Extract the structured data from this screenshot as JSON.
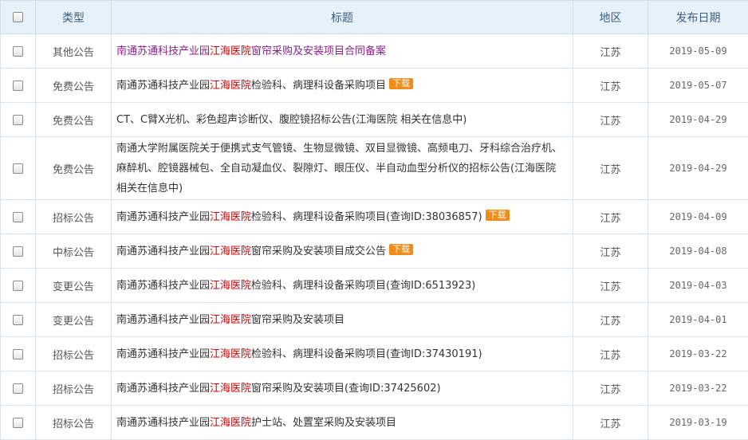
{
  "header": {
    "type": "类型",
    "title": "标题",
    "region": "地区",
    "date": "发布日期"
  },
  "rows": [
    {
      "type": "其他公告",
      "pre": "南通苏通科技产业园",
      "hl": "江海医院",
      "post": "窗帘采购及安装项目合同备案",
      "download": "",
      "region": "江苏",
      "date": "2019-05-09"
    },
    {
      "type": "免费公告",
      "pre": "南通苏通科技产业园",
      "hl": "江海医院",
      "post": "检验科、病理科设备采购项目",
      "download": "下载",
      "region": "江苏",
      "date": "2019-05-07"
    },
    {
      "type": "免费公告",
      "pre": "CT、C臂X光机、彩色超声诊断仪、腹腔镜招标公告(江海医院 相关在信息中)",
      "hl": "",
      "post": "",
      "download": "",
      "region": "江苏",
      "date": "2019-04-29"
    },
    {
      "type": "免费公告",
      "pre": "南通大学附属医院关于便携式支气管镜、生物显微镜、双目显微镜、高频电刀、牙科综合治疗机、麻醉机、腔镜器械包、全自动凝血仪、裂隙灯、眼压仪、半自动血型分析仪的招标公告(江海医院 相关在信息中)",
      "hl": "",
      "post": "",
      "download": "",
      "region": "江苏",
      "date": "2019-04-29"
    },
    {
      "type": "招标公告",
      "pre": "南通苏通科技产业园",
      "hl": "江海医院",
      "post": "检验科、病理科设备采购项目(查询ID:38036857)",
      "download": "下载",
      "region": "江苏",
      "date": "2019-04-09"
    },
    {
      "type": "中标公告",
      "pre": "南通苏通科技产业园",
      "hl": "江海医院",
      "post": "窗帘采购及安装项目成交公告",
      "download": "下载",
      "region": "江苏",
      "date": "2019-04-08"
    },
    {
      "type": "变更公告",
      "pre": "南通苏通科技产业园",
      "hl": "江海医院",
      "post": "检验科、病理科设备采购项目(查询ID:6513923)",
      "download": "",
      "region": "江苏",
      "date": "2019-04-03"
    },
    {
      "type": "变更公告",
      "pre": "南通苏通科技产业园",
      "hl": "江海医院",
      "post": "窗帘采购及安装项目",
      "download": "",
      "region": "江苏",
      "date": "2019-04-01"
    },
    {
      "type": "招标公告",
      "pre": "南通苏通科技产业园",
      "hl": "江海医院",
      "post": "检验科、病理科设备采购项目(查询ID:37430191)",
      "download": "",
      "region": "江苏",
      "date": "2019-03-22"
    },
    {
      "type": "招标公告",
      "pre": "南通苏通科技产业园",
      "hl": "江海医院",
      "post": "窗帘采购及安装项目(查询ID:37425602)",
      "download": "",
      "region": "江苏",
      "date": "2019-03-22"
    },
    {
      "type": "招标公告",
      "pre": "南通苏通科技产业园",
      "hl": "江海医院",
      "post": "护士站、处置室采购及安装项目",
      "download": "",
      "region": "江苏",
      "date": "2019-03-19"
    }
  ]
}
